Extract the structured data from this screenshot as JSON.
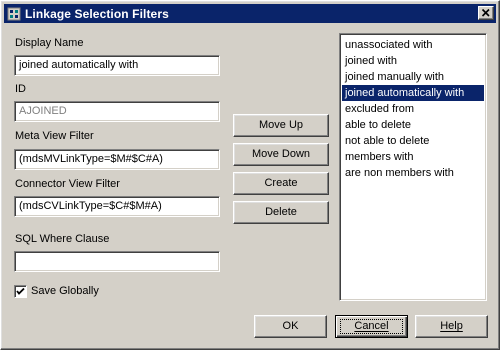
{
  "window": {
    "title": "Linkage Selection Filters",
    "close_glyph": "×"
  },
  "form": {
    "display_name": {
      "label": "Display Name",
      "value": "joined automatically with"
    },
    "id": {
      "label": "ID",
      "value": "AJOINED"
    },
    "meta_view_filter": {
      "label": "Meta View Filter",
      "value": "(mdsMVLinkType=$M#$C#A)"
    },
    "connector_view_filter": {
      "label": "Connector View Filter",
      "value": "(mdsCVLinkType=$C#$M#A)"
    },
    "sql_where_clause": {
      "label": "SQL Where Clause",
      "value": ""
    },
    "save_globally": {
      "label": "Save Globally",
      "checked": true
    }
  },
  "actions": {
    "move_up": "Move Up",
    "move_down": "Move Down",
    "create": "Create",
    "delete": "Delete"
  },
  "list": {
    "items": [
      "unassociated with",
      "joined with",
      "joined manually with",
      "joined automatically with",
      "excluded from",
      "able to delete",
      "not able to delete",
      "members with",
      "are non members with"
    ],
    "selected_index": 3
  },
  "footer": {
    "ok": "OK",
    "cancel": "Cancel",
    "help": "Help"
  },
  "colors": {
    "titlebar": "#0a246a",
    "selection": "#0a246a",
    "face": "#d4d0c8"
  }
}
